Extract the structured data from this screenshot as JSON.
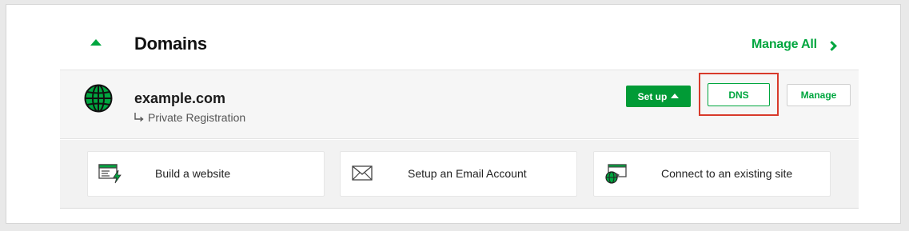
{
  "section": {
    "title": "Domains",
    "manage_all_label": "Manage All"
  },
  "domain": {
    "name": "example.com",
    "subtitle": "Private Registration"
  },
  "buttons": {
    "setup_label": "Set up",
    "dns_label": "DNS",
    "manage_label": "Manage"
  },
  "actions": [
    {
      "label": "Build a website",
      "icon": "website-builder-icon"
    },
    {
      "label": "Setup an Email Account",
      "icon": "envelope-icon"
    },
    {
      "label": "Connect to an existing site",
      "icon": "connect-site-icon"
    }
  ],
  "colors": {
    "accent": "#00a63f",
    "setup_bg": "#019b36",
    "highlight": "#d83a2b"
  }
}
